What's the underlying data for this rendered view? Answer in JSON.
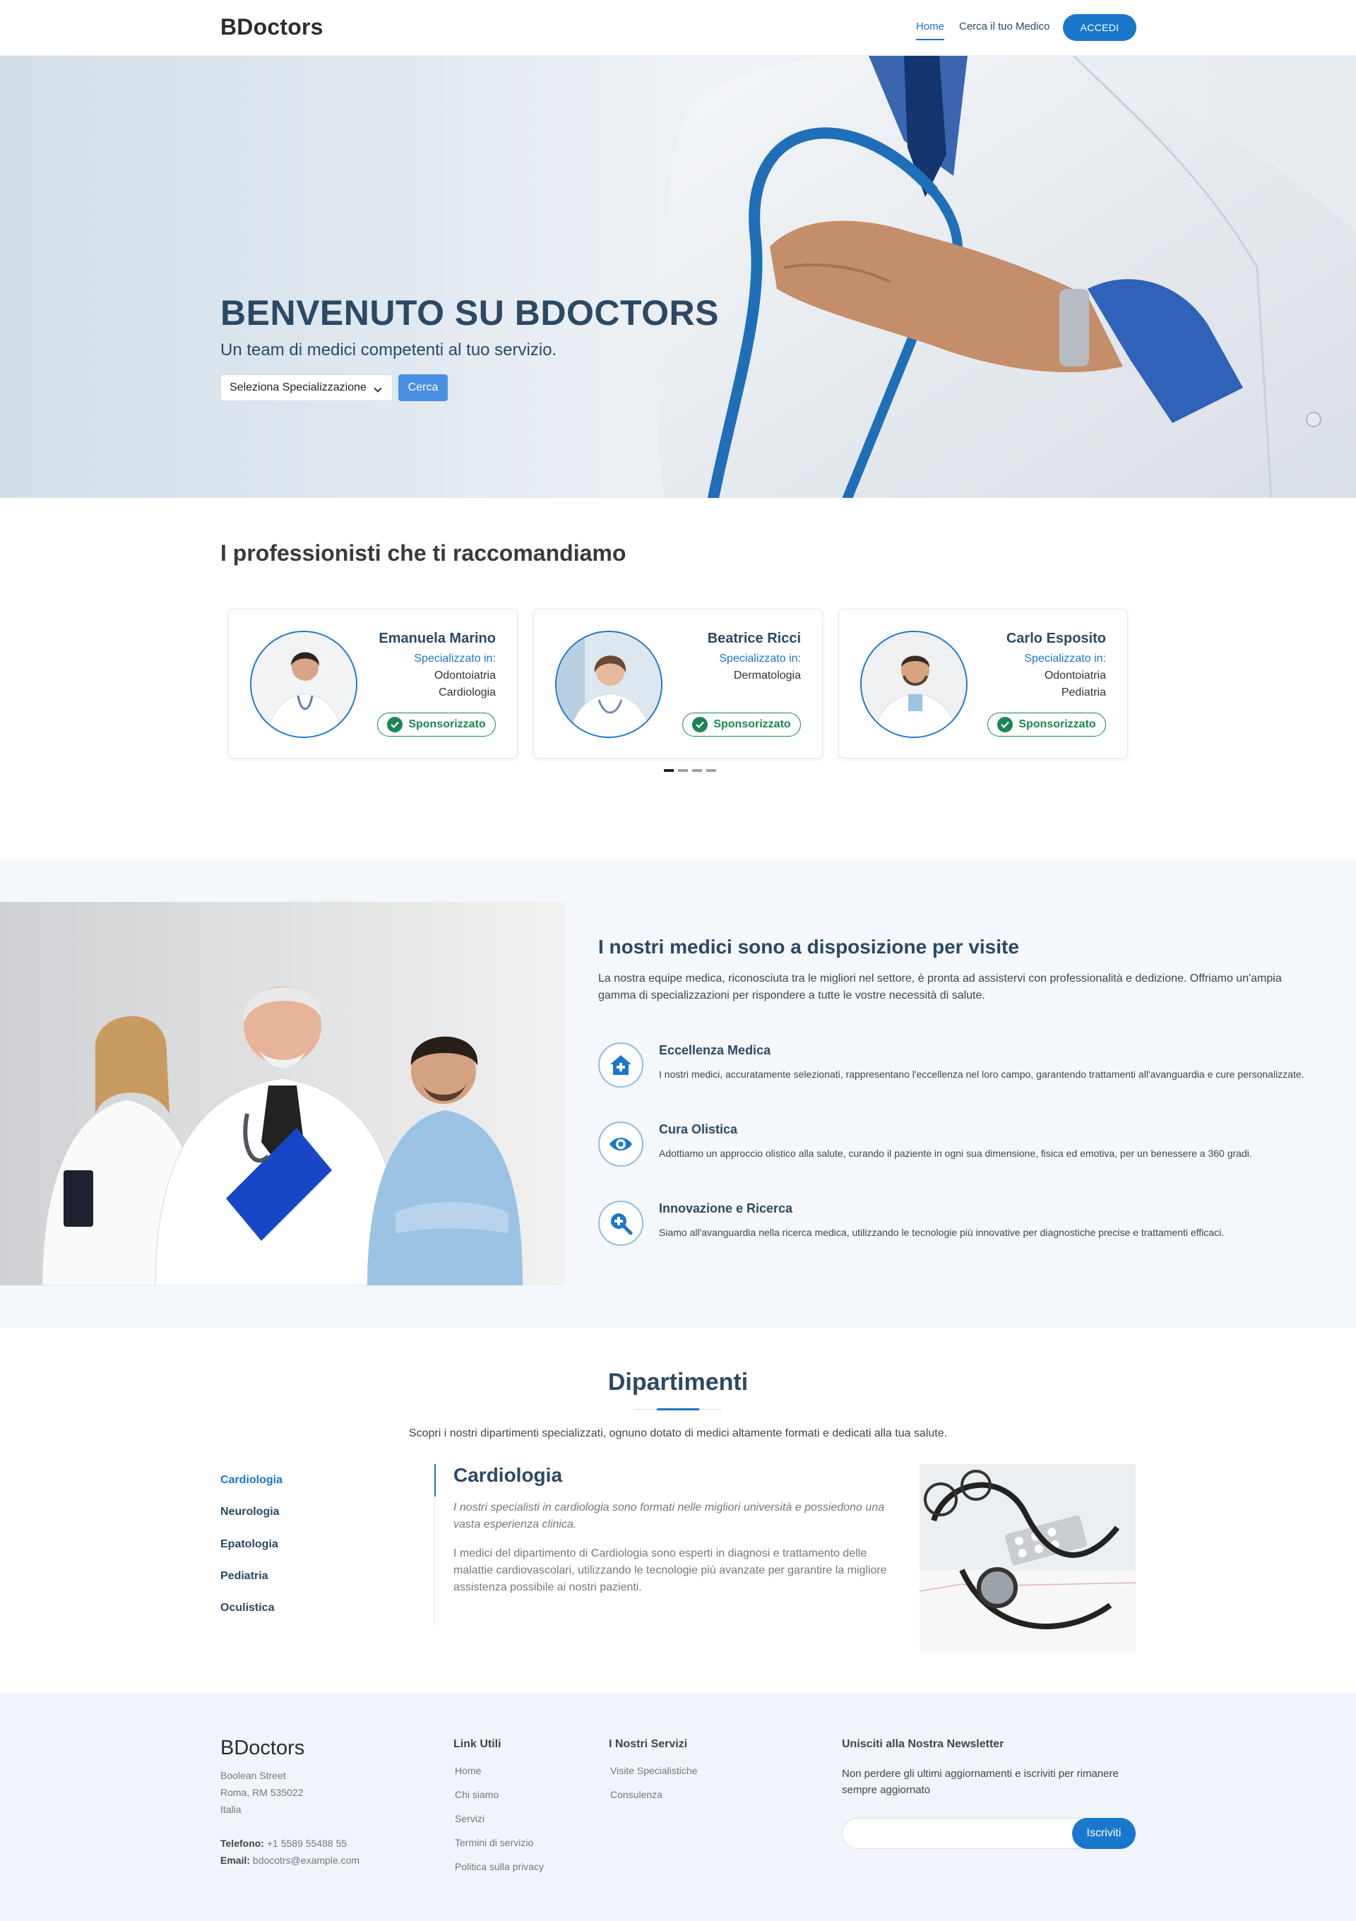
{
  "header": {
    "logo": "BDoctors",
    "nav": {
      "home": "Home",
      "search": "Cerca il tuo Medico"
    },
    "login": "ACCEDI"
  },
  "hero": {
    "title": "BENVENUTO SU BDOCTORS",
    "subtitle": "Un team di medici competenti al tuo servizio.",
    "select_value": "Seleziona Specializzazione",
    "search_button": "Cerca"
  },
  "recommended": {
    "title": "I professionisti che ti raccomandiamo",
    "spec_label": "Specializzato in:",
    "badge": "Sponsorizzato",
    "doctors": [
      {
        "name": "Emanuela Marino",
        "specializations": [
          "Odontoiatria",
          "Cardiologia"
        ]
      },
      {
        "name": "Beatrice Ricci",
        "specializations": [
          "Dermatologia"
        ]
      },
      {
        "name": "Carlo Esposito",
        "specializations": [
          "Odontoiatria",
          "Pediatria"
        ]
      }
    ],
    "carousel_pages": 4,
    "carousel_active": 1
  },
  "about": {
    "title": "I nostri medici sono a disposizione per visite",
    "text": "La nostra equipe medica, riconosciuta tra le migliori nel settore, è pronta ad assistervi con professionalità e dedizione. Offriamo un'ampia gamma di specializzazioni per rispondere a tutte le vostre necessità di salute.",
    "features": [
      {
        "icon": "house-medical-icon",
        "title": "Eccellenza Medica",
        "text": "I nostri medici, accuratamente selezionati, rappresentano l'eccellenza nel loro campo, garantendo trattamenti all'avanguardia e cure personalizzate."
      },
      {
        "icon": "eye-icon",
        "title": "Cura Olistica",
        "text": "Adottiamo un approccio olistico alla salute, curando il paziente in ogni sua dimensione, fisica ed emotiva, per un benessere a 360 gradi."
      },
      {
        "icon": "search-plus-icon",
        "title": "Innovazione e Ricerca",
        "text": "Siamo all'avanguardia nella ricerca medica, utilizzando le tecnologie più innovative per diagnostiche precise e trattamenti efficaci."
      }
    ]
  },
  "departments": {
    "title": "Dipartimenti",
    "intro": "Scopri i nostri dipartimenti specializzati, ognuno dotato di medici altamente formati e dedicati alla tua salute.",
    "tabs": [
      "Cardiologia",
      "Neurologia",
      "Epatologia",
      "Pediatria",
      "Oculistica"
    ],
    "active": {
      "name": "Cardiologia",
      "lead": "I nostri specialisti in cardiologia sono formati nelle migliori università e possiedono una vasta esperienza clinica.",
      "description": "I medici del dipartimento di Cardiologia sono esperti in diagnosi e trattamento delle malattie cardiovascolari, utilizzando le tecnologie più avanzate per garantire la migliore assistenza possibile ai nostri pazienti."
    }
  },
  "footer": {
    "logo": "BDoctors",
    "address": [
      "Boolean Street",
      "Roma, RM 535022",
      "Italia"
    ],
    "phone_label": "Telefono:",
    "phone": "+1 5589 55488 55",
    "email_label": "Email:",
    "email": "bdocotrs@example.com",
    "links_title": "Link Utili",
    "links": [
      "Home",
      "Chi siamo",
      "Servizi",
      "Termini di servizio",
      "Politica sulla privacy"
    ],
    "services_title": "I Nostri Servizi",
    "services": [
      "Visite Specialistiche",
      "Consulenza"
    ],
    "newsletter_title": "Unisciti alla Nostra Newsletter",
    "newsletter_text": "Non perdere gli ultimi aggiornamenti e iscriviti per rimanere sempre aggiornato",
    "newsletter_button": "Iscriviti"
  },
  "colors": {
    "primary": "#1977cc",
    "heading": "#2c4964",
    "success": "#198754",
    "section_bg": "#f4f7fc"
  }
}
